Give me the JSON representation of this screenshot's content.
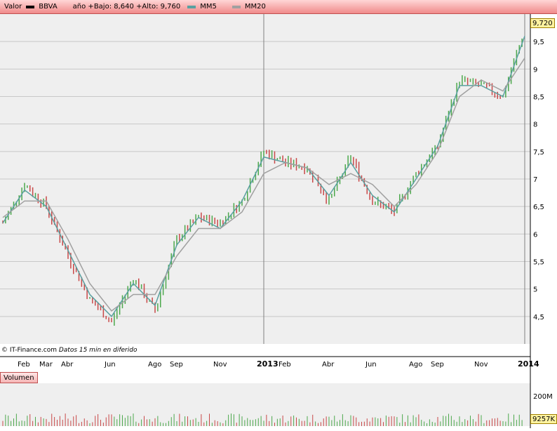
{
  "header": {
    "valor_label": "Valor",
    "ticker": "BBVA",
    "range_text": "año +Bajo: 8,640 +Alto: 9,760",
    "ma5_label": "MM5",
    "ma20_label": "MM20"
  },
  "colors": {
    "up": "#4ca84c",
    "down": "#c84848",
    "ma5": "#5aa0a0",
    "ma20": "#a0a0a0",
    "grid": "#c8c8c8",
    "panel_bg": "#efefef"
  },
  "source_text": "IT-Finance.com",
  "source_note": "Datos 15 min en diferido",
  "source_icon": "copyright-icon",
  "last_price_label": "9,720",
  "volume": {
    "title": "Volumen",
    "axis_label": "200M",
    "last_label": "9257K"
  },
  "chart_data": {
    "type": "line",
    "xlabel": "",
    "ylabel": "",
    "ylim": [
      4.0,
      10.0
    ],
    "yticks": [
      4.5,
      5,
      5.5,
      6,
      6.5,
      7,
      7.5,
      8,
      8.5,
      9,
      9.5
    ],
    "ytick_labels": [
      "4,5",
      "5",
      "5,5",
      "6",
      "6,5",
      "7",
      "7,5",
      "8",
      "8,5",
      "9",
      "9,5"
    ],
    "xticks": [
      "Feb",
      "Mar",
      "Abr",
      "Jun",
      "Ago",
      "Sep",
      "Nov",
      "2013",
      "Feb",
      "Abr",
      "Jun",
      "Ago",
      "Sep",
      "Nov",
      "2014"
    ],
    "x": [
      "2012-01",
      "2012-02",
      "2012-03",
      "2012-04",
      "2012-05",
      "2012-06",
      "2012-07",
      "2012-08",
      "2012-09",
      "2012-10",
      "2012-11",
      "2012-12",
      "2013-01",
      "2013-02",
      "2013-03",
      "2013-04",
      "2013-05",
      "2013-06",
      "2013-07",
      "2013-08",
      "2013-09",
      "2013-10",
      "2013-11",
      "2013-12",
      "2014-01"
    ],
    "series": [
      {
        "name": "BBVA",
        "values": [
          6.2,
          6.9,
          6.5,
          5.6,
          4.8,
          4.4,
          5.2,
          4.6,
          5.9,
          6.3,
          6.2,
          6.6,
          7.5,
          7.3,
          7.2,
          6.6,
          7.4,
          6.6,
          6.4,
          7.1,
          7.6,
          8.8,
          8.7,
          8.5,
          9.72
        ]
      },
      {
        "name": "MM5",
        "values": [
          6.2,
          6.8,
          6.5,
          5.7,
          4.9,
          4.5,
          5.1,
          4.7,
          5.8,
          6.3,
          6.1,
          6.6,
          7.4,
          7.3,
          7.2,
          6.7,
          7.3,
          6.7,
          6.4,
          7.0,
          7.6,
          8.7,
          8.7,
          8.5,
          9.6
        ]
      },
      {
        "name": "MM20",
        "values": [
          6.3,
          6.6,
          6.6,
          5.9,
          5.1,
          4.6,
          4.9,
          4.9,
          5.6,
          6.1,
          6.1,
          6.4,
          7.1,
          7.3,
          7.2,
          6.9,
          7.1,
          6.9,
          6.5,
          6.9,
          7.5,
          8.5,
          8.8,
          8.6,
          9.2
        ]
      }
    ],
    "grid": true,
    "legend": "top-left"
  }
}
